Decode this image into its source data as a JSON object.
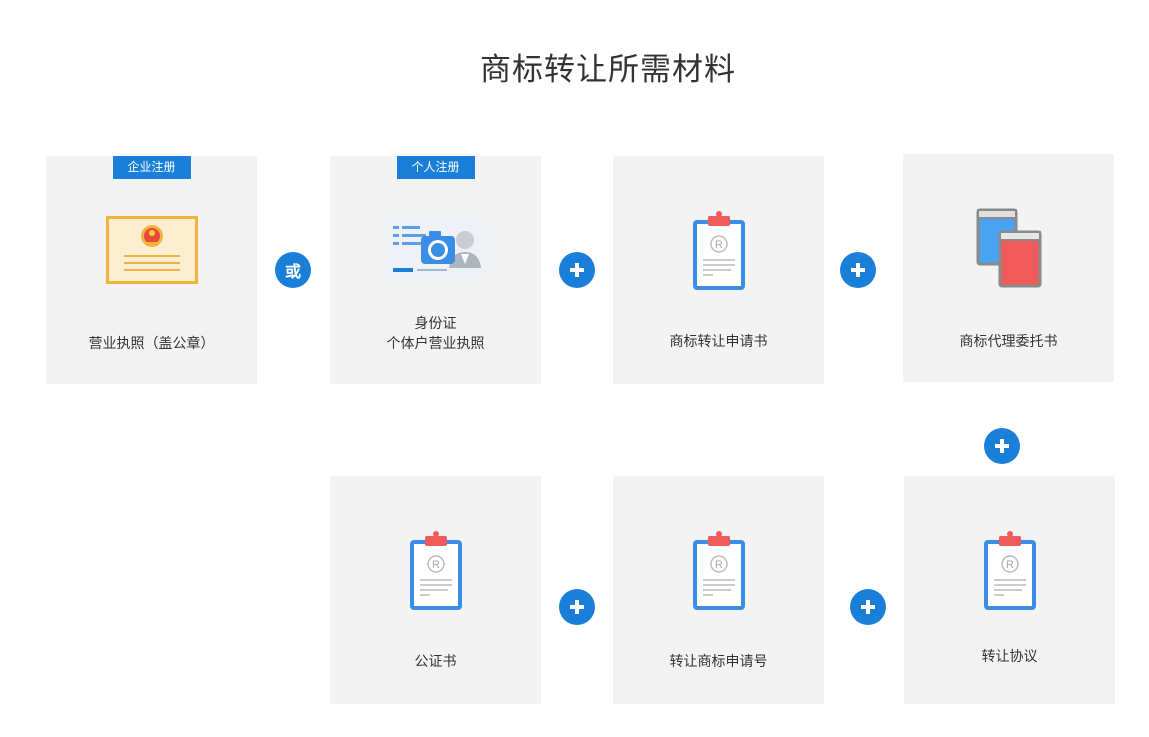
{
  "page": {
    "title": "商标转让所需材料"
  },
  "cards": {
    "business_license": {
      "badge": "企业注册",
      "label": "营业执照（盖公章）",
      "icon": "certificate-icon"
    },
    "id_card": {
      "badge": "个人注册",
      "label_line1": "身份证",
      "label_line2": "个体户营业执照",
      "icon": "id-card-camera-icon"
    },
    "transfer_application": {
      "label": "商标转让申请书",
      "icon": "clipboard-trademark-icon"
    },
    "agency_authorization": {
      "label": "商标代理委托书",
      "icon": "books-icon"
    },
    "notarial_certificate": {
      "label": "公证书",
      "icon": "clipboard-trademark-icon"
    },
    "transfer_application_number": {
      "label": "转让商标申请号",
      "icon": "clipboard-trademark-icon"
    },
    "transfer_agreement": {
      "label": "转让协议",
      "icon": "clipboard-trademark-icon"
    }
  },
  "connectors": {
    "or_label": "或",
    "plus_icon": "plus-icon"
  },
  "colors": {
    "accent": "#1a7fd9",
    "card_bg": "#f3f3f3",
    "clip_red": "#f05a5a",
    "certificate_gold": "#f2b23c"
  }
}
